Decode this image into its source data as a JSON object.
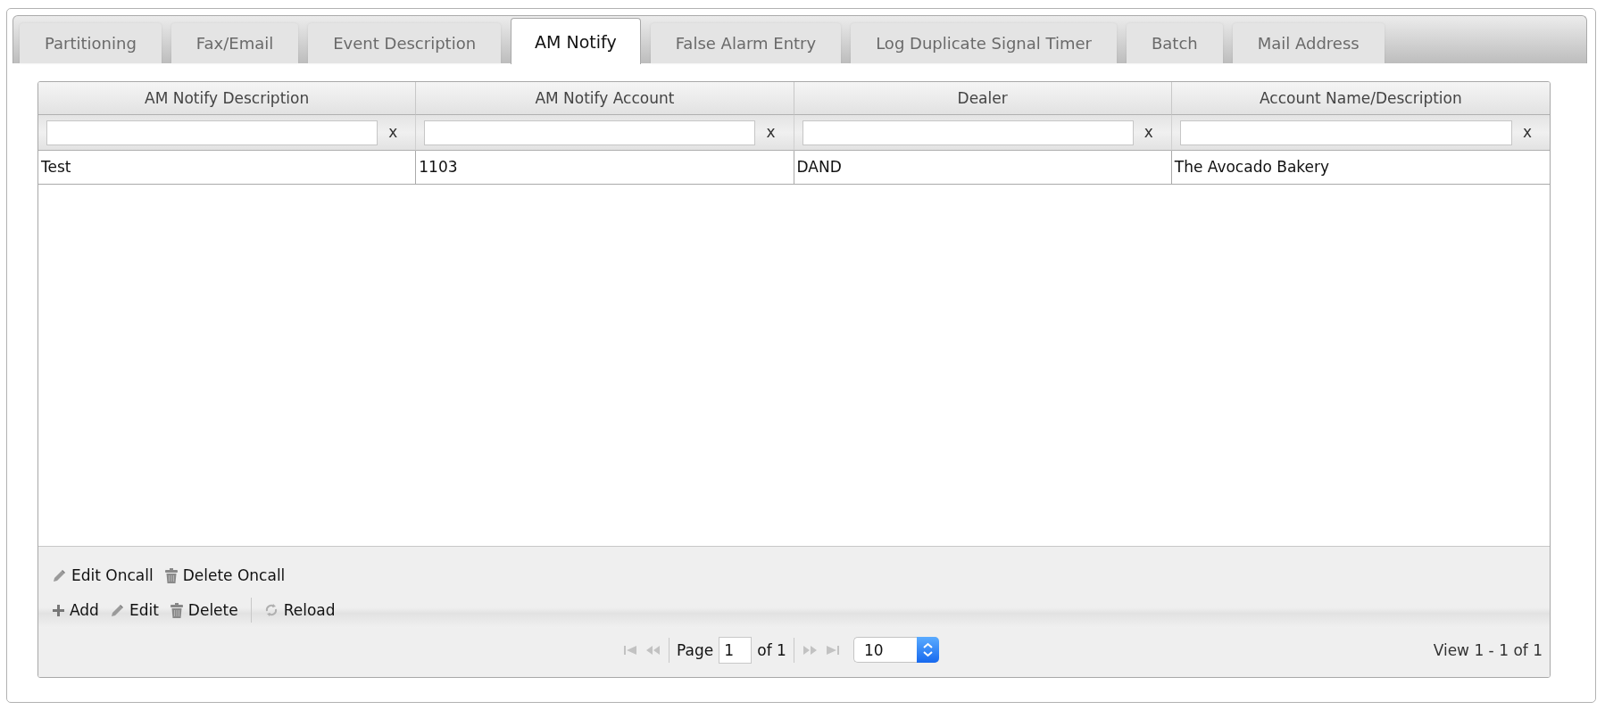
{
  "tabs": [
    {
      "label": "Partitioning",
      "selected": false
    },
    {
      "label": "Fax/Email",
      "selected": false
    },
    {
      "label": "Event Description",
      "selected": false
    },
    {
      "label": "AM Notify",
      "selected": true
    },
    {
      "label": "False Alarm Entry",
      "selected": false
    },
    {
      "label": "Log Duplicate Signal Timer",
      "selected": false
    },
    {
      "label": "Batch",
      "selected": false
    },
    {
      "label": "Mail Address",
      "selected": false
    }
  ],
  "grid": {
    "columns": [
      "AM Notify Description",
      "AM Notify Account",
      "Dealer",
      "Account Name/Description"
    ],
    "filters": [
      {
        "clear": "x"
      },
      {
        "clear": "x"
      },
      {
        "clear": "x"
      },
      {
        "clear": "x"
      }
    ],
    "rows": [
      {
        "cells": [
          "Test",
          "1103",
          "DAND",
          "The Avocado Bakery"
        ],
        "selected": false
      }
    ],
    "toolbars": [
      {
        "buttons": [
          {
            "kind": "edit",
            "label": "Edit Oncall"
          },
          {
            "kind": "delete",
            "label": "Delete Oncall"
          }
        ]
      },
      {
        "buttons": [
          {
            "kind": "add",
            "label": "Add"
          },
          {
            "kind": "edit",
            "label": "Edit"
          },
          {
            "kind": "delete",
            "label": "Delete"
          },
          {
            "kind": "separator"
          },
          {
            "kind": "reload",
            "label": "Reload"
          }
        ]
      }
    ],
    "pager": {
      "nav_back": [
        {
          "kind": "first",
          "disabled": true
        },
        {
          "kind": "prev",
          "disabled": true
        }
      ],
      "page_label": "Page",
      "page": "1",
      "page_total": "of 1",
      "nav_forward": [
        {
          "kind": "next",
          "disabled": true
        },
        {
          "kind": "last",
          "disabled": true
        }
      ],
      "page_size": "10",
      "record_info": "View 1 - 1 of 1"
    }
  }
}
